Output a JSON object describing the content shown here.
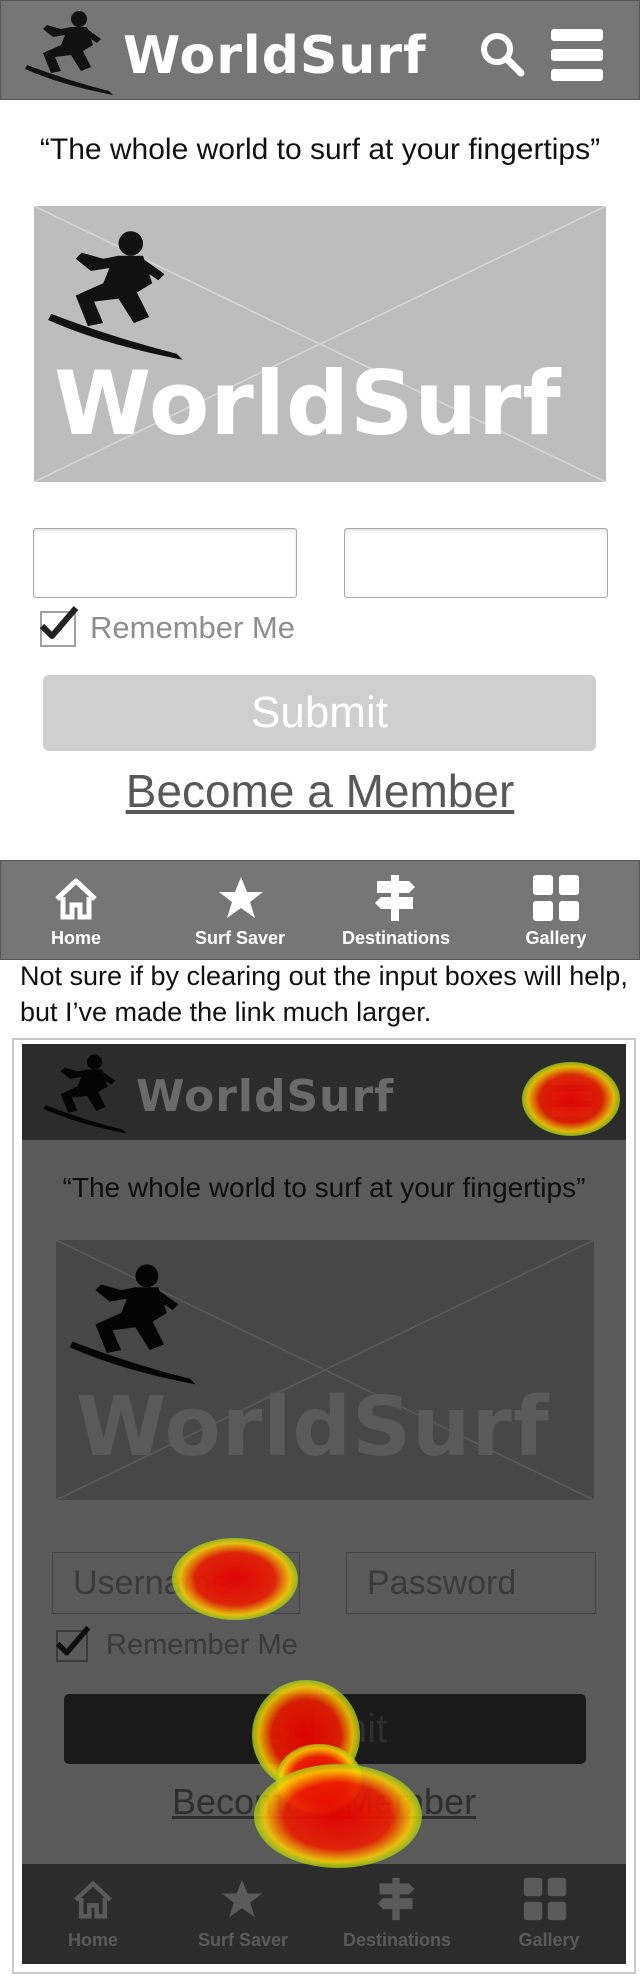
{
  "header": {
    "title": "WorldSurf"
  },
  "tagline": "“The whole world to surf at your fingertips”",
  "hero": {
    "logo_text": "WorldSurf"
  },
  "login": {
    "remember_label": "Remember Me",
    "submit_label": "Submit",
    "member_link": "Become a Member"
  },
  "tabs": [
    {
      "label": "Home",
      "icon": "home-icon"
    },
    {
      "label": "Surf Saver",
      "icon": "star-icon"
    },
    {
      "label": "Destinations",
      "icon": "signpost-icon"
    },
    {
      "label": "Gallery",
      "icon": "grid-icon"
    }
  ],
  "note": "Not sure if by clearing out the input boxes will help, but I’ve made the link much larger.",
  "heatmap_screenshot": {
    "title": "WorldSurf",
    "tagline": "“The whole world to surf at your fingertips”",
    "logo_text": "WorldSurf",
    "username_placeholder": "Username",
    "password_placeholder": "Password",
    "remember_label": "Remember Me",
    "submit_label": "Submit",
    "member_link": "Become a Member",
    "tabs": [
      "Home",
      "Surf Saver",
      "Destinations",
      "Gallery"
    ]
  },
  "colors": {
    "header_bg": "#767676",
    "placeholder_bg": "#bdbdbd",
    "button_bg": "#cfcfcf",
    "heat_hot": "#e60000"
  }
}
